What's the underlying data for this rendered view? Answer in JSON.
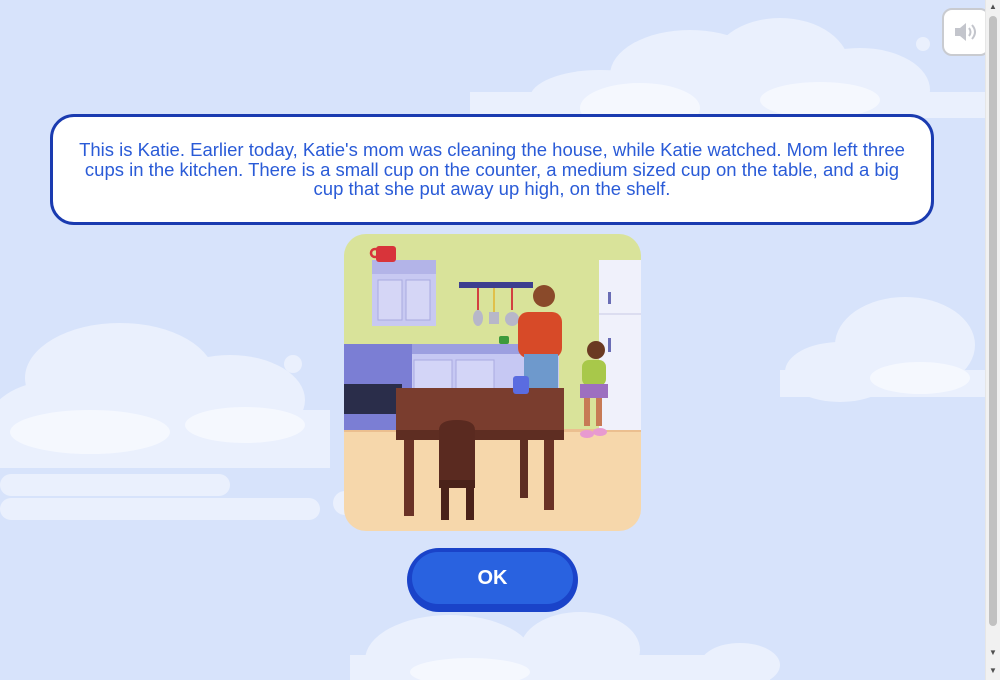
{
  "prompt": {
    "text": "This is Katie. Earlier today, Katie's mom was cleaning the house, while Katie watched. Mom left three cups in the kitchen. There is a small cup on the counter, a medium sized cup on the table, and a big cup that she put away up high, on the shelf."
  },
  "ok_button": {
    "label": "OK"
  },
  "colors": {
    "background": "#d7e3fb",
    "text_blue": "#2a5bd7",
    "border_navy": "#1a3bb0",
    "button_blue": "#2962e0"
  },
  "icons": {
    "sound": "speaker-icon"
  }
}
